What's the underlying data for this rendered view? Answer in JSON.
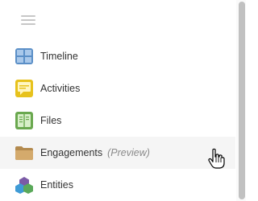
{
  "nav": {
    "items": [
      {
        "label": "Timeline",
        "icon": "timeline-icon",
        "color": "#5b8fc7"
      },
      {
        "label": "Activities",
        "icon": "activities-icon",
        "color": "#e7c21c"
      },
      {
        "label": "Files",
        "icon": "files-icon",
        "color": "#6aa84f"
      },
      {
        "label": "Engagements",
        "tag": "(Preview)",
        "icon": "folder-icon",
        "color": "#c9a063",
        "state": "hover"
      },
      {
        "label": "Entities",
        "icon": "entities-icon",
        "color": "#7b5aa6"
      }
    ]
  },
  "cursor": {
    "icon": "hand-pointer-icon"
  }
}
